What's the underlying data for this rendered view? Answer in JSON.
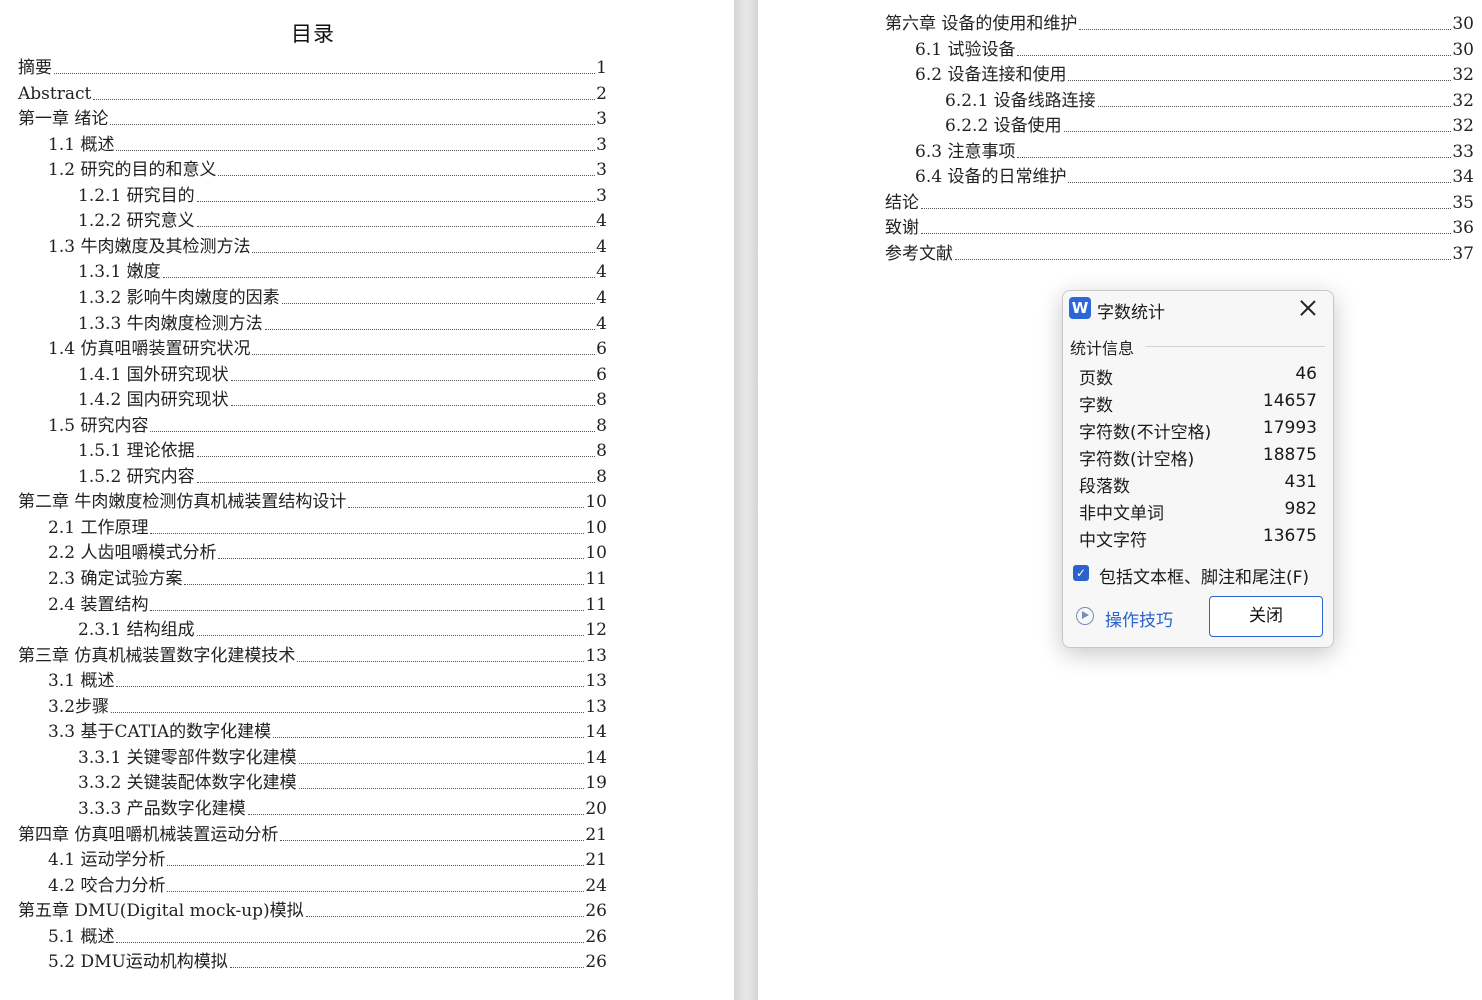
{
  "left_page": {
    "title": "目录",
    "entries": [
      {
        "text": "摘要",
        "page": "1"
      },
      {
        "text": "Abstract",
        "page": "2"
      },
      {
        "text": "第一章 绪论",
        "page": "3"
      },
      {
        "text": "1.1 概述",
        "page": "3"
      },
      {
        "text": "1.2 研究的目的和意义",
        "page": "3"
      },
      {
        "text": "1.2.1 研究目的",
        "page": "3"
      },
      {
        "text": "1.2.2 研究意义",
        "page": "4"
      },
      {
        "text": "1.3 牛肉嫩度及其检测方法",
        "page": "4"
      },
      {
        "text": "1.3.1 嫩度",
        "page": "4"
      },
      {
        "text": "1.3.2 影响牛肉嫩度的因素",
        "page": "4"
      },
      {
        "text": "1.3.3 牛肉嫩度检测方法",
        "page": "4"
      },
      {
        "text": "1.4 仿真咀嚼装置研究状况",
        "page": "6"
      },
      {
        "text": "1.4.1 国外研究现状",
        "page": "6"
      },
      {
        "text": "1.4.2 国内研究现状",
        "page": "8"
      },
      {
        "text": "1.5 研究内容",
        "page": "8"
      },
      {
        "text": "1.5.1 理论依据",
        "page": "8"
      },
      {
        "text": "1.5.2 研究内容",
        "page": "8"
      },
      {
        "text": "第二章 牛肉嫩度检测仿真机械装置结构设计",
        "page": "10"
      },
      {
        "text": "2.1 工作原理",
        "page": "10"
      },
      {
        "text": "2.2 人齿咀嚼模式分析",
        "page": "10"
      },
      {
        "text": "2.3 确定试验方案",
        "page": "11"
      },
      {
        "text": "2.4 装置结构",
        "page": "11"
      },
      {
        "text": "2.3.1 结构组成",
        "page": "12"
      },
      {
        "text": "第三章 仿真机械装置数字化建模技术",
        "page": "13"
      },
      {
        "text": "3.1 概述",
        "page": "13"
      },
      {
        "text": "3.2步骤",
        "page": "13"
      },
      {
        "text": "3.3 基于CATIA的数字化建模",
        "page": "14"
      },
      {
        "text": "3.3.1 关键零部件数字化建模",
        "page": "14"
      },
      {
        "text": "3.3.2 关键装配体数字化建模",
        "page": "19"
      },
      {
        "text": "3.3.3 产品数字化建模",
        "page": "20"
      },
      {
        "text": "第四章 仿真咀嚼机械装置运动分析",
        "page": "21"
      },
      {
        "text": "4.1 运动学分析",
        "page": "21"
      },
      {
        "text": "4.2 咬合力分析",
        "page": "24"
      },
      {
        "text": "第五章 DMU(Digital mock-up)模拟",
        "page": "26"
      },
      {
        "text": "5.1 概述",
        "page": "26"
      },
      {
        "text": "5.2 DMU运动机构模拟",
        "page": "26"
      }
    ]
  },
  "right_page": {
    "entries": [
      {
        "text": "第六章 设备的使用和维护",
        "page": "30"
      },
      {
        "text": "6.1 试验设备",
        "page": "30"
      },
      {
        "text": "6.2 设备连接和使用",
        "page": "32"
      },
      {
        "text": "6.2.1 设备线路连接",
        "page": "32"
      },
      {
        "text": "6.2.2 设备使用",
        "page": "32"
      },
      {
        "text": "6.3 注意事项",
        "page": "33"
      },
      {
        "text": "6.4 设备的日常维护",
        "page": "34"
      },
      {
        "text": "结论",
        "page": "35"
      },
      {
        "text": "致谢",
        "page": "36"
      },
      {
        "text": "参考文献",
        "page": "37"
      }
    ]
  },
  "dialog": {
    "app_icon_letter": "W",
    "title": "字数统计",
    "section_label": "统计信息",
    "stats": [
      {
        "label": "页数",
        "value": "46"
      },
      {
        "label": "字数",
        "value": "14657"
      },
      {
        "label": "字符数(不计空格)",
        "value": "17993"
      },
      {
        "label": "字符数(计空格)",
        "value": "18875"
      },
      {
        "label": "段落数",
        "value": "431"
      },
      {
        "label": "非中文单词",
        "value": "982"
      },
      {
        "label": "中文字符",
        "value": "13675"
      }
    ],
    "checkbox_label": "包括文本框、脚注和尾注(F)",
    "checkbox_checked": true,
    "tips_label": "操作技巧",
    "close_label": "关闭",
    "accent_color": "#2a63c9"
  }
}
